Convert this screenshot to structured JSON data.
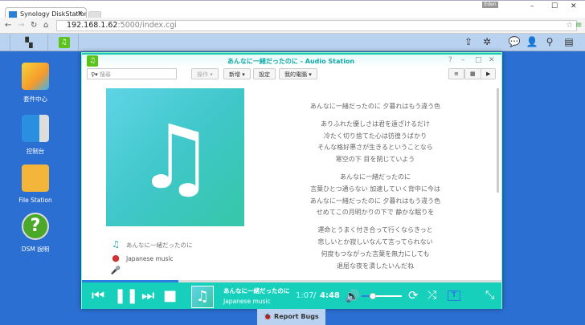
{
  "browser": {
    "tab_title": "Synology DiskStation",
    "url_host": "192.168.1.62",
    "url_rest": ":5000/index.cgi",
    "user_badge": "Eden"
  },
  "desktop": {
    "icons": [
      {
        "label": "套件中心"
      },
      {
        "label": "控制台"
      },
      {
        "label": "File Station"
      },
      {
        "label": "DSM 說明"
      }
    ]
  },
  "window": {
    "title": "あんなに一緒だったのに - Audio Station",
    "search_placeholder": "搜尋",
    "toolbar": [
      "操作 ▾",
      "新增 ▾",
      "設定",
      "我的電腦 ▾"
    ]
  },
  "song": {
    "title": "あんなに一緒だったのに",
    "album": "Japanese music",
    "current_time": "1:07",
    "total_time": "4:48",
    "progress": 0.23,
    "volume": 0.2
  },
  "lyrics": [
    [
      "あんなに一緒だったのに 夕暮れはもう違う色"
    ],
    [
      "ありふれた優しさは君を遠ざけるだけ",
      "冷たく切り捨てた心は彷徨うばかり",
      "そんな格好悪さが生きるということなら",
      "寒空の下 目を閉じていよう"
    ],
    [
      "あんなに一緒だったのに",
      "言葉ひとつ通らない 加速していく背中に今は",
      "あんなに一緒だったのに 夕暮れはもう違う色",
      "せめてこの月明かりの下で 静かな眠りを"
    ],
    [
      "運命とうまく付き合って行くならきっと",
      "悲しいとか寂しいなんて言ってられない",
      "何度もつながった言葉を無力にしても",
      "退屈な夜を潰したいんだね"
    ]
  ],
  "report_bugs": "Report Bugs",
  "colors": {
    "accent": "#16d0bc",
    "desktop": "#2b6fd3"
  }
}
